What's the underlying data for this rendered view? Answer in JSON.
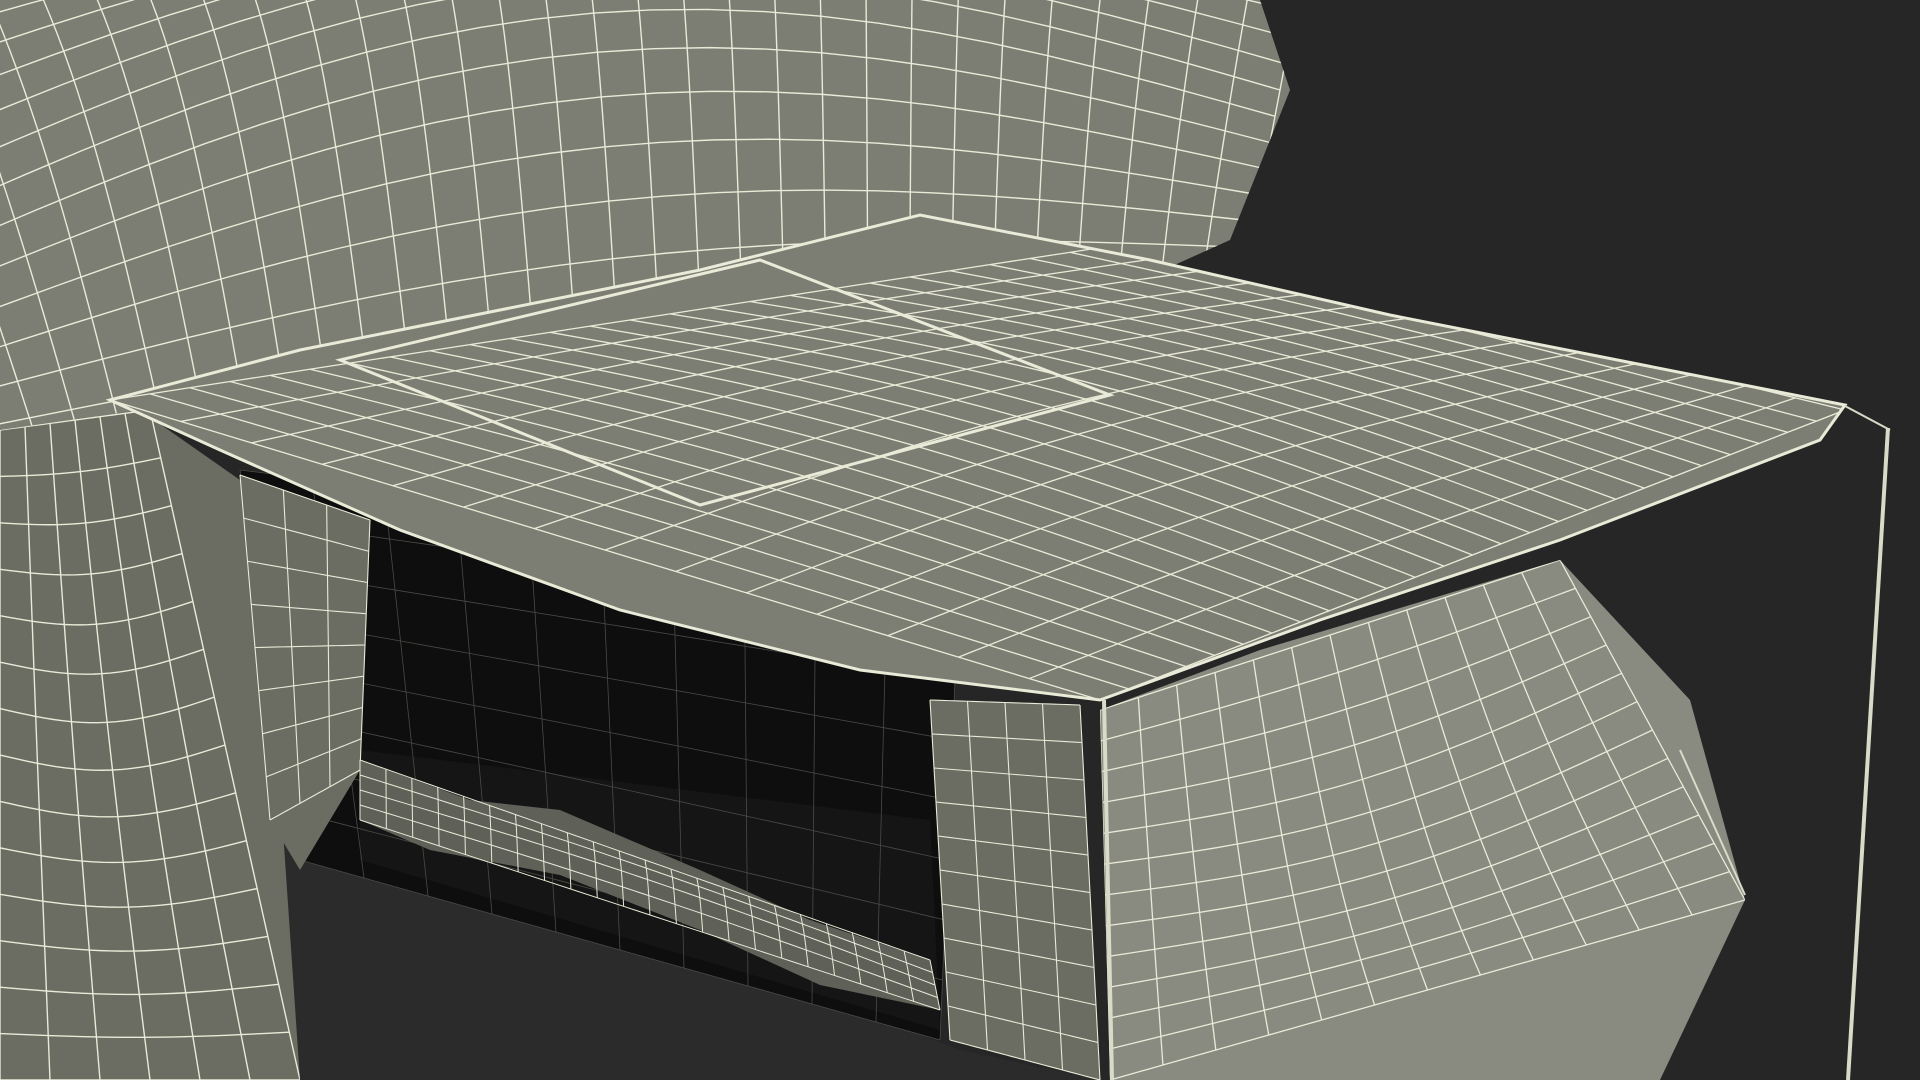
{
  "viewport": {
    "background": "#262626"
  },
  "model": {
    "subject": "tent-with-awning-wireframe",
    "shading": "solid-with-wireframe-overlay",
    "colors": {
      "surface": "#7d7e73",
      "surface_light": "#8a8b80",
      "surface_dark": "#6b6c62",
      "interior": "#0e0e0e",
      "interior_floor": "#151515",
      "wire": "#e9ead7",
      "wire_dim": "#4a4a46",
      "pole": "#d9dac8",
      "bedding": "#5f6058"
    }
  }
}
